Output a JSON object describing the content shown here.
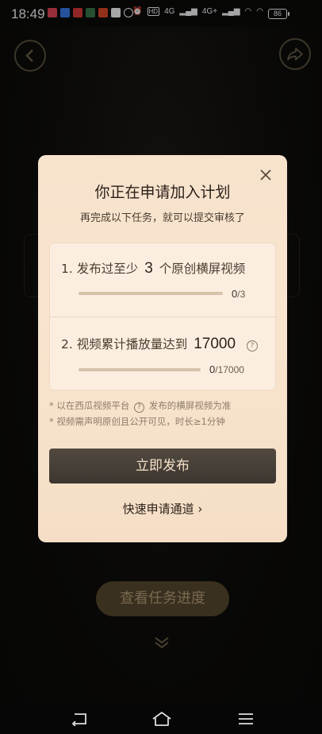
{
  "status_bar": {
    "time": "18:49",
    "battery": "86",
    "network_1": "4G",
    "network_2": "4G+",
    "hd_label": "HD"
  },
  "background": {
    "check_progress_label": "查看任务进度"
  },
  "modal": {
    "title": "你正在申请加入计划",
    "subtitle": "再完成以下任务，就可以提交审核了",
    "tasks": [
      {
        "prefix": "1. 发布过至少",
        "number": "3",
        "suffix": "个原创横屏视频",
        "current": "0",
        "total": "/3",
        "progress": 0
      },
      {
        "prefix": "2. 视频累计播放量达到",
        "number": "17000",
        "suffix": "",
        "current": "0",
        "total": "/17000",
        "progress": 0
      }
    ],
    "note1_a": "* 以在西瓜视频平台",
    "note1_b": "发布的横屏视频为准",
    "note2": "* 视频需声明原创且公开可见，时长≥1分钟",
    "publish_label": "立即发布",
    "fast_link_label": "快速申请通道 ›"
  },
  "colors": {
    "modal_bg": "#f7e3cc",
    "publish_bg": "#4a433a",
    "publish_text": "#f5e2c8",
    "progress_button_bg": "#5a4a30"
  }
}
